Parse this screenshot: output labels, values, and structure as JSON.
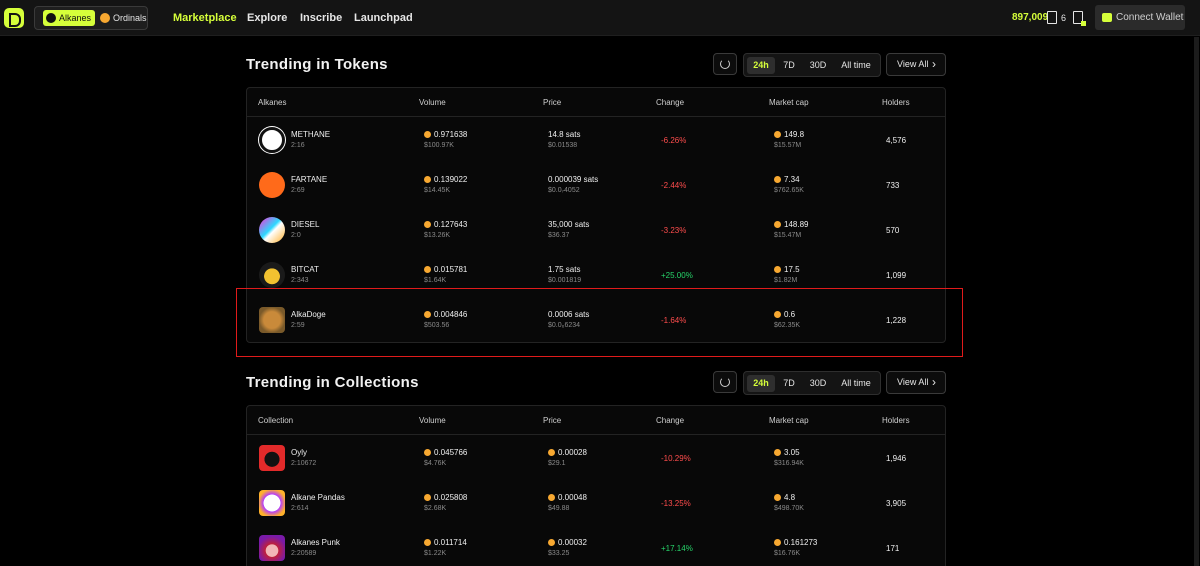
{
  "nav": {
    "chains": [
      "Alkanes",
      "Ordinals"
    ],
    "links": [
      "Marketplace",
      "Explore",
      "Inscribe",
      "Launchpad"
    ],
    "fee_rate": "897,009",
    "pending_count": "6",
    "connect_label": "Connect Wallet"
  },
  "tokens": {
    "title": "Trending in Tokens",
    "timeframes": [
      "24h",
      "7D",
      "30D",
      "All time"
    ],
    "view_all": "View All",
    "headers": [
      "Alkanes",
      "Volume",
      "Price",
      "Change",
      "Market cap",
      "Holders"
    ],
    "rows": [
      {
        "name": "METHANE",
        "id": "2:16",
        "volume": "0.971638",
        "volume_usd": "$100.97K",
        "price": "14.8 sats",
        "price_usd": "$0.01538",
        "change": "-6.26%",
        "mcap": "149.8",
        "mcap_usd": "$15.57M",
        "holders": "4,576"
      },
      {
        "name": "FARTANE",
        "id": "2:69",
        "volume": "0.139022",
        "volume_usd": "$14.45K",
        "price": "0.000039 sats",
        "price_usd": "$0.0₇4052",
        "change": "-2.44%",
        "mcap": "7.34",
        "mcap_usd": "$762.65K",
        "holders": "733"
      },
      {
        "name": "DIESEL",
        "id": "2:0",
        "volume": "0.127643",
        "volume_usd": "$13.26K",
        "price": "35,000 sats",
        "price_usd": "$36.37",
        "change": "-3.23%",
        "mcap": "148.89",
        "mcap_usd": "$15.47M",
        "holders": "570"
      },
      {
        "name": "BITCAT",
        "id": "2:343",
        "volume": "0.015781",
        "volume_usd": "$1.64K",
        "price": "1.75 sats",
        "price_usd": "$0.001819",
        "change": "+25.00%",
        "mcap": "17.5",
        "mcap_usd": "$1.82M",
        "holders": "1,099"
      },
      {
        "name": "AlkaDoge",
        "id": "2:59",
        "volume": "0.004846",
        "volume_usd": "$503.56",
        "price": "0.0006 sats",
        "price_usd": "$0.0₆6234",
        "change": "-1.64%",
        "mcap": "0.6",
        "mcap_usd": "$62.35K",
        "holders": "1,228"
      }
    ]
  },
  "collections": {
    "title": "Trending in Collections",
    "timeframes": [
      "24h",
      "7D",
      "30D",
      "All time"
    ],
    "view_all": "View All",
    "headers": [
      "Collection",
      "Volume",
      "Price",
      "Change",
      "Market cap",
      "Holders"
    ],
    "rows": [
      {
        "name": "Oyly",
        "id": "2:10672",
        "volume": "0.045766",
        "volume_usd": "$4.76K",
        "price": "0.00028",
        "price_usd": "$29.1",
        "change": "-10.29%",
        "mcap": "3.05",
        "mcap_usd": "$316.94K",
        "holders": "1,946"
      },
      {
        "name": "Alkane Pandas",
        "id": "2:614",
        "volume": "0.025808",
        "volume_usd": "$2.68K",
        "price": "0.00048",
        "price_usd": "$49.88",
        "change": "-13.25%",
        "mcap": "4.8",
        "mcap_usd": "$498.70K",
        "holders": "3,905"
      },
      {
        "name": "Alkanes Punk",
        "id": "2:20589",
        "volume": "0.011714",
        "volume_usd": "$1.22K",
        "price": "0.00032",
        "price_usd": "$33.25",
        "change": "+17.14%",
        "mcap": "0.161273",
        "mcap_usd": "$16.76K",
        "holders": "171"
      }
    ]
  },
  "colors": {
    "accent": "#d6ff3a",
    "negative": "#ff4d4d",
    "positive": "#27d46a",
    "coin": "#f7a831",
    "highlight": "#e01b1b"
  }
}
